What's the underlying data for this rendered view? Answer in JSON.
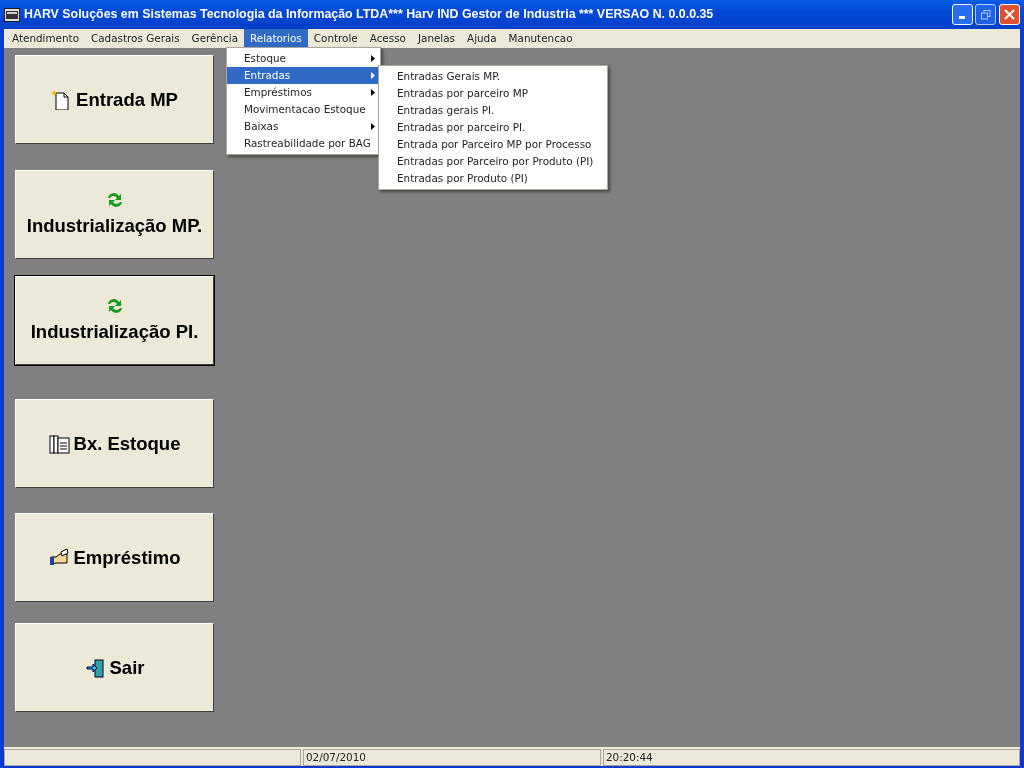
{
  "window": {
    "title": "HARV Soluções em Sistemas Tecnologia da Informação LTDA*** Harv IND Gestor de Industria *** VERSAO N.  0.0.0.35"
  },
  "menubar": [
    {
      "label": "Atendimento",
      "selected": false
    },
    {
      "label": "Cadastros Gerais",
      "selected": false
    },
    {
      "label": "Gerência",
      "selected": false
    },
    {
      "label": "Relatorios",
      "selected": true
    },
    {
      "label": "Controle",
      "selected": false
    },
    {
      "label": "Acesso",
      "selected": false
    },
    {
      "label": "Janelas",
      "selected": false
    },
    {
      "label": "Ajuda",
      "selected": false
    },
    {
      "label": "Manutencao",
      "selected": false
    }
  ],
  "dropdown": [
    {
      "label": "Estoque",
      "submenu": true,
      "selected": false
    },
    {
      "label": "Entradas",
      "submenu": true,
      "selected": true
    },
    {
      "label": "Empréstimos",
      "submenu": true,
      "selected": false
    },
    {
      "label": "Movimentacao Estoque",
      "submenu": false,
      "selected": false
    },
    {
      "label": "Baixas",
      "submenu": true,
      "selected": false
    },
    {
      "label": "Rastreabilidade por BAG",
      "submenu": false,
      "selected": false
    }
  ],
  "submenu": [
    {
      "label": "Entradas Gerais MP."
    },
    {
      "label": "Entradas por parceiro MP"
    },
    {
      "label": "Entradas gerais PI."
    },
    {
      "label": "Entradas por parceiro PI."
    },
    {
      "label": "Entrada por Parceiro MP por Processo"
    },
    {
      "label": "Entradas por Parceiro por Produto (PI)"
    },
    {
      "label": "Entradas por Produto (PI)"
    }
  ],
  "buttons": [
    {
      "label": "Entrada MP",
      "kind": "new-document",
      "focused": false
    },
    {
      "label": "Industrialização MP.",
      "kind": "refresh",
      "focused": false
    },
    {
      "label": "Industrialização PI.",
      "kind": "refresh",
      "focused": true
    },
    {
      "label": "Bx. Estoque",
      "kind": "documents",
      "focused": false
    },
    {
      "label": "Empréstimo",
      "kind": "hand",
      "focused": false
    },
    {
      "label": "Sair",
      "kind": "exit",
      "focused": false
    }
  ],
  "status_bar": [
    "02/07/2010",
    "20:20:44"
  ]
}
